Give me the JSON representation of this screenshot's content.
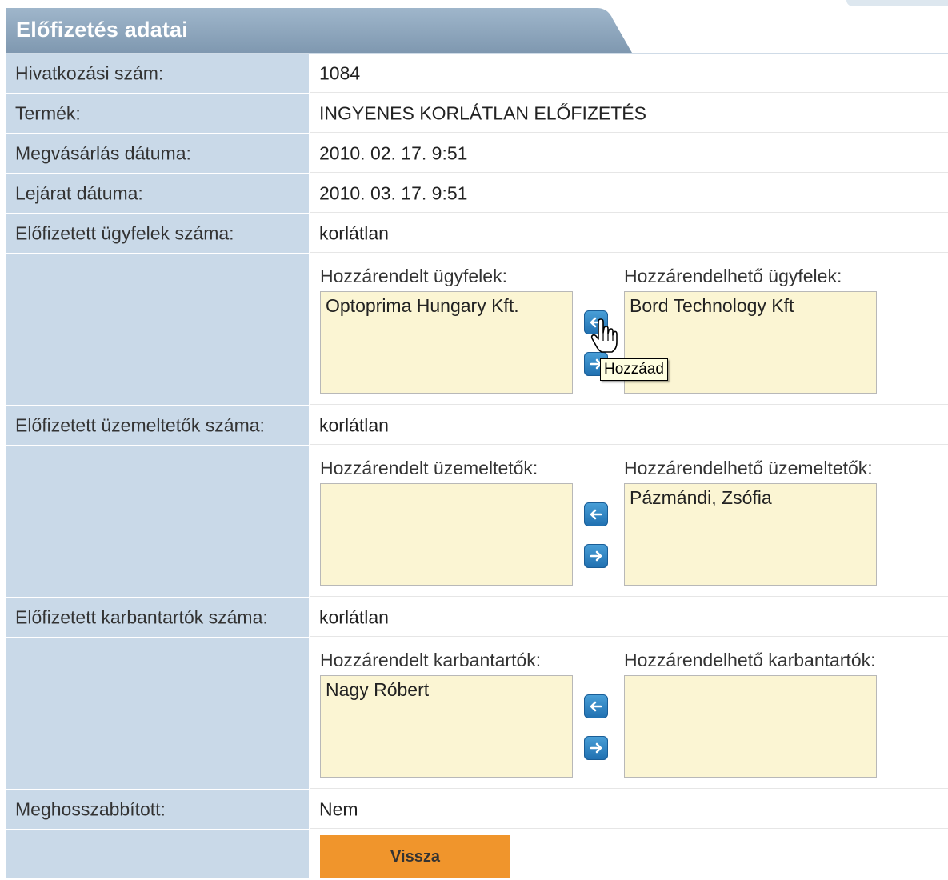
{
  "panel": {
    "title": "Előfizetés adatai"
  },
  "fields": {
    "reference": {
      "label": "Hivatkozási szám:",
      "value": "1084"
    },
    "product": {
      "label": "Termék:",
      "value": "INGYENES KORLÁTLAN ELŐFIZETÉS"
    },
    "purchase_date": {
      "label": "Megvásárlás dátuma:",
      "value": "2010. 02. 17. 9:51"
    },
    "expiry_date": {
      "label": "Lejárat dátuma:",
      "value": "2010. 03. 17. 9:51"
    },
    "clients_count": {
      "label": "Előfizetett ügyfelek száma:",
      "value": "korlátlan"
    },
    "operators_count": {
      "label": "Előfizetett üzemeltetők száma:",
      "value": "korlátlan"
    },
    "maintainers_count": {
      "label": "Előfizetett karbantartók száma:",
      "value": "korlátlan"
    },
    "extended": {
      "label": "Meghosszabbított:",
      "value": "Nem"
    }
  },
  "clients": {
    "assigned_label": "Hozzárendelt ügyfelek:",
    "assignable_label": "Hozzárendelhető ügyfelek:",
    "assigned": [
      "Optoprima Hungary Kft."
    ],
    "assignable": [
      "Bord Technology Kft"
    ]
  },
  "operators": {
    "assigned_label": "Hozzárendelt üzemeltetők:",
    "assignable_label": "Hozzárendelhető üzemeltetők:",
    "assigned": [],
    "assignable": [
      "Pázmándi, Zsófia"
    ]
  },
  "maintainers": {
    "assigned_label": "Hozzárendelt karbantartók:",
    "assignable_label": "Hozzárendelhető karbantartók:",
    "assigned": [
      "Nagy Róbert"
    ],
    "assignable": []
  },
  "tooltip": {
    "text": "Hozzáad"
  },
  "buttons": {
    "back": "Vissza"
  },
  "icons": {
    "move_left": "arrow-left-icon",
    "move_right": "arrow-right-icon",
    "cursor": "hand-pointer-icon"
  },
  "colors": {
    "header": "#8fa7be",
    "label_bg": "#c9d9e8",
    "list_bg": "#fbf5d3",
    "button": "#f0952c",
    "arrow_btn": "#2c82c4"
  }
}
